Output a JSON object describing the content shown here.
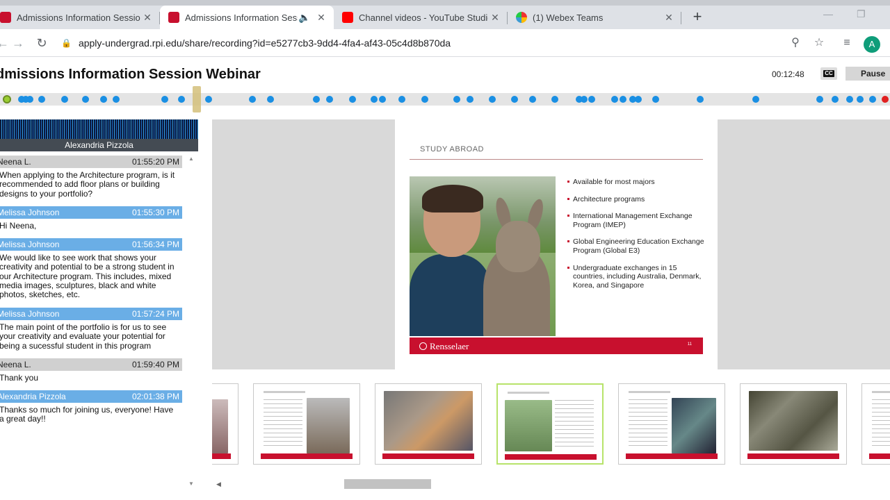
{
  "browser": {
    "tabs": [
      {
        "title": "Admissions Information Session W",
        "active": false,
        "favicon": "rpi-icon",
        "color": "#c8102e"
      },
      {
        "title": "Admissions Information Session",
        "active": true,
        "favicon": "rpi-icon",
        "color": "#c8102e",
        "audio": true
      },
      {
        "title": "Channel videos - YouTube Studio",
        "active": false,
        "favicon": "youtube-icon",
        "color": "#ff0000"
      },
      {
        "title": "(1) Webex Teams",
        "active": false,
        "favicon": "webex-icon",
        "color": "#3b9bd3"
      }
    ],
    "url": "apply-undergrad.rpi.edu/share/recording?id=e5277cb3-9dd4-4fa4-af43-05c4d8b870da",
    "profile_initial": "A"
  },
  "webinar": {
    "title": "dmissions Information Session Webinar",
    "elapsed": "00:12:48",
    "cc_label": "CC",
    "pause_label": "Pause"
  },
  "speaker": {
    "name": "Alexandria Pizzola"
  },
  "chat": [
    {
      "author": "Neena L.",
      "time": "01:55:20 PM",
      "style": "gray",
      "text": "When applying to the Architecture program, is it recommended to add floor plans or building designs to your portfolio?"
    },
    {
      "author": "Melissa Johnson",
      "time": "01:55:30 PM",
      "style": "blue",
      "text": "Hi Neena,"
    },
    {
      "author": "Melissa Johnson",
      "time": "01:56:34 PM",
      "style": "blue",
      "text": "We would like to see work that shows your creativity and potential to be a strong student in our Architecture program. This includes, mixed media images, sculptures, black and white photos, sketches, etc."
    },
    {
      "author": "Melissa Johnson",
      "time": "01:57:24 PM",
      "style": "blue",
      "text": "The main point of the portfolio is for us to see your creativity and evaluate your potential for being a sucessful student in this program"
    },
    {
      "author": "Neena L.",
      "time": "01:59:40 PM",
      "style": "gray",
      "text": "Thank you"
    },
    {
      "author": "Alexandria Pizzola",
      "time": "02:01:38 PM",
      "style": "blue",
      "text": "Thanks so much for joining us, everyone! Have a great day!!"
    }
  ],
  "slide": {
    "heading": "STUDY ABROAD",
    "bullets": [
      "Available for most majors",
      "Architecture programs",
      "International Management Exchange Program (IMEP)",
      "Global Engineering Education Exchange Program (Global E3)",
      "Undergraduate exchanges in 15 countries, including Australia, Denmark, Korea, and Singapore"
    ],
    "brand": "Rensselaer",
    "page_number": "11"
  },
  "colors": {
    "accent": "#c8102e",
    "timeline_marker": "#1a8fe3",
    "chat_blue": "#6aaee6"
  }
}
